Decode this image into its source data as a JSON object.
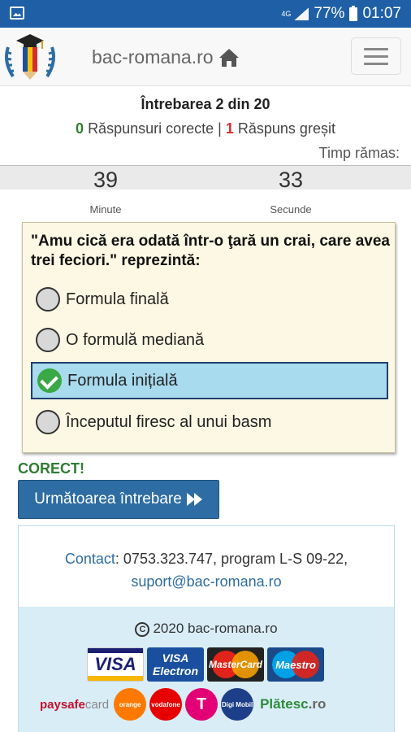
{
  "status_bar": {
    "network": "4G",
    "battery": "77%",
    "time": "01:07"
  },
  "navbar": {
    "brand": "bac-romana.ro"
  },
  "quiz": {
    "title": "Întrebarea 2 din 20",
    "correct_count": "0",
    "correct_label": "Răspunsuri corecte",
    "separator": "|",
    "wrong_count": "1",
    "wrong_label": "Răspuns greșit",
    "time_left_label": "Timp rămas:"
  },
  "timer": {
    "minutes_value": "39",
    "minutes_label": "Minute",
    "seconds_value": "33",
    "seconds_label": "Secunde"
  },
  "question": {
    "text": "\"Amu cică era odată într-o ţară un crai, care avea trei feciori.\" reprezintă:",
    "options": [
      {
        "label": "Formula finală",
        "selected": false
      },
      {
        "label": "O formulă mediană",
        "selected": false
      },
      {
        "label": "Formula inițială",
        "selected": true
      },
      {
        "label": "Începutul firesc al unui basm",
        "selected": false
      }
    ]
  },
  "result": {
    "text": "CORECT!"
  },
  "next_button": {
    "label": "Următoarea întrebare"
  },
  "footer": {
    "contact_link": "Contact",
    "contact_text": ": 0753.323.747, program L-S 09-22,",
    "email": "suport@bac-romana.ro",
    "copyright": "2020 bac-romana.ro",
    "cards": [
      "VISA",
      "VISA",
      "Electron",
      "MasterCard",
      "Maestro"
    ],
    "payments": {
      "paysafe_pay": "paysafe",
      "paysafe_card": "card",
      "orange": "orange",
      "vodafone": "vodafone",
      "tmobile": "T",
      "digi": "Digi Mobil",
      "platesc_a": "Plătesc",
      "platesc_b": ".ro"
    }
  }
}
